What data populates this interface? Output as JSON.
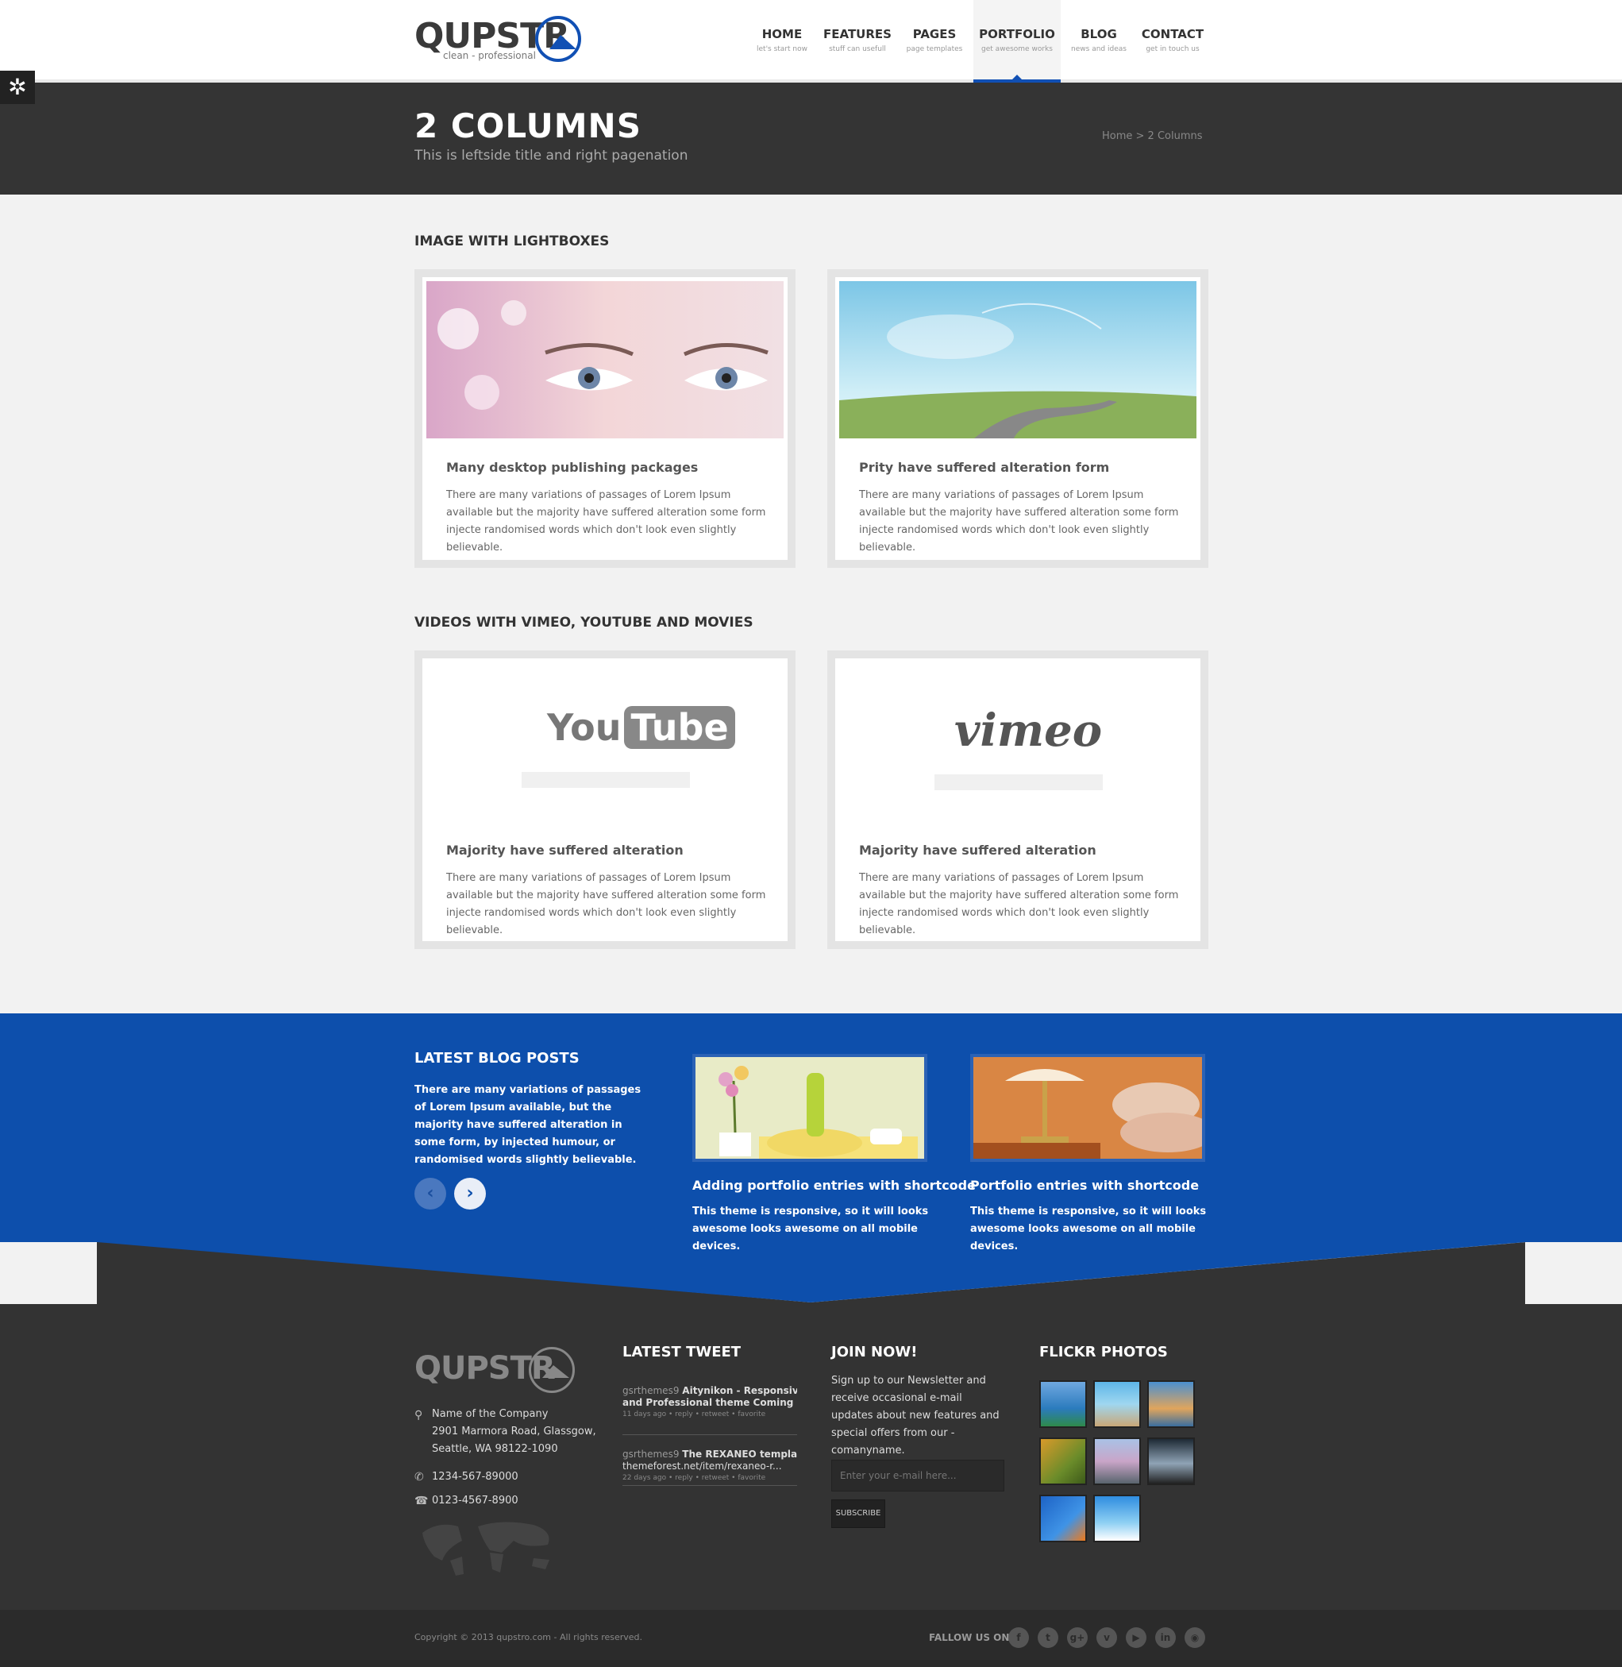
{
  "logo": {
    "text": "QUPSTR",
    "tagline": "clean - professional"
  },
  "nav": [
    {
      "label": "HOME",
      "sub": "let's start now"
    },
    {
      "label": "FEATURES",
      "sub": "stuff can usefull"
    },
    {
      "label": "PAGES",
      "sub": "page templates"
    },
    {
      "label": "PORTFOLIO",
      "sub": "get awesome works",
      "active": true
    },
    {
      "label": "BLOG",
      "sub": "news and ideas"
    },
    {
      "label": "CONTACT",
      "sub": "get in touch us"
    }
  ],
  "page": {
    "title": "2 COLUMNS",
    "subtitle": "This is leftside title and right pagenation",
    "breadcrumb": "Home > 2 Columns"
  },
  "sections": {
    "images_title": "IMAGE WITH LIGHTBOXES",
    "videos_title": "VIDEOS WITH VIMEO, YOUTUBE AND MOVIES"
  },
  "cards": [
    {
      "title": "Many desktop publishing packages",
      "text": "There are many variations of passages of Lorem Ipsum available but the majority have suffered alteration some form injecte randomised words which don't look even slightly believable."
    },
    {
      "title": "Prity have suffered alteration form",
      "text": "There are many variations of passages of Lorem Ipsum available but the majority have suffered alteration some form injecte randomised words which don't look even slightly believable."
    },
    {
      "title": "Majority have suffered alteration",
      "text": "There are many variations of passages of Lorem Ipsum available but the majority have suffered alteration some form injecte randomised words which don't look even slightly believable.",
      "logo_a": "You",
      "logo_b": "Tube"
    },
    {
      "title": "Majority have suffered alteration",
      "text": "There are many variations of passages of Lorem Ipsum available but the majority have suffered alteration some form injecte randomised words which don't look even slightly believable.",
      "logo": "vimeo"
    }
  ],
  "blog": {
    "title": "LATEST BLOG POSTS",
    "text": "There are many variations of passages of Lorem Ipsum available, but the majority have suffered alteration in some form, by injected humour, or randomised words slightly believable.",
    "posts": [
      {
        "title": "Adding portfolio entries with shortcode",
        "text": "This theme is responsive, so it will looks awesome looks awesome on all mobile devices."
      },
      {
        "title": "Portfolio entries with shortcode",
        "text": "This theme is responsive, so it will looks awesome looks awesome on all mobile devices."
      }
    ]
  },
  "footer": {
    "logo": "QUPSTR",
    "address": [
      "Name of the Company",
      "2901 Marmora Road, Glassgow,",
      "Seattle, WA 98122-1090"
    ],
    "phone": "1234-567-89000",
    "fax": "0123-4567-8900",
    "tweet_title": "LATEST TWEET",
    "tweets": [
      {
        "user": "gsrthemes9",
        "line1": "Aitynikon - Responsive HT",
        "line2": "and Professional theme Coming soon.",
        "meta": "11 days ago • reply • retweet • favorite"
      },
      {
        "user": "gsrthemes9",
        "line1": "The REXANEO template o",
        "line2": "themeforest.net/item/rexaneo-r...",
        "meta": "22 days ago • reply • retweet • favorite"
      }
    ],
    "join_title": "JOIN NOW!",
    "join_text": "Sign up to our Newsletter and receive occasional e-mail updates about new features and special offers from our - comanyname.",
    "email_placeholder": "Enter your e-mail here...",
    "subscribe": "SUBSCRIBE",
    "flickr_title": "FLICKR PHOTOS",
    "copyright": "Copyright © 2013 qupstro.com - All rights reserved.",
    "follow": "FALLOW US ON:"
  }
}
